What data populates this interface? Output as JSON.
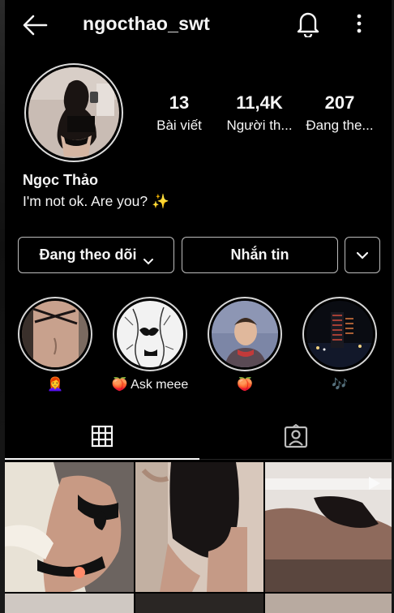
{
  "header": {
    "username": "ngocthao_swt",
    "icons": [
      "back-arrow-icon",
      "bell-icon",
      "more-vertical-icon"
    ]
  },
  "profile": {
    "name": "Ngọc Thảo",
    "bio": "I'm not ok. Are you? ✨",
    "stats": [
      {
        "value": "13",
        "label": "Bài viết"
      },
      {
        "value": "11,4K",
        "label": "Người th..."
      },
      {
        "value": "207",
        "label": "Đang the..."
      }
    ]
  },
  "actions": {
    "following_label": "Đang theo dõi",
    "message_label": "Nhắn tin"
  },
  "highlights": [
    {
      "label": "👩‍🦰"
    },
    {
      "label": "🍑 Ask meee"
    },
    {
      "label": "🍑"
    },
    {
      "label": "🎶"
    }
  ],
  "tabs": [
    {
      "icon": "grid-icon",
      "active": true
    },
    {
      "icon": "tagged-person-icon",
      "active": false
    }
  ],
  "colors": {
    "background": "#000000",
    "text": "#f5f5f5",
    "button_border": "#bdbdbd"
  }
}
